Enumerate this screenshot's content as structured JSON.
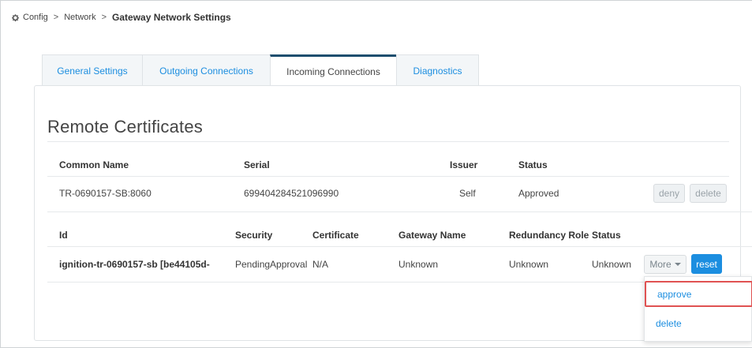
{
  "breadcrumb": {
    "root": "Config",
    "section": "Network",
    "current": "Gateway Network Settings"
  },
  "tabs": [
    {
      "label": "General Settings"
    },
    {
      "label": "Outgoing Connections"
    },
    {
      "label": "Incoming Connections",
      "active": true
    },
    {
      "label": "Diagnostics"
    }
  ],
  "certificates": {
    "title": "Remote Certificates",
    "columns": [
      "Common Name",
      "Serial",
      "Issuer",
      "Status"
    ],
    "rows": [
      {
        "common_name": "TR-0690157-SB:8060",
        "serial": "699404284521096990",
        "issuer": "Self",
        "status": "Approved",
        "deny_label": "deny",
        "delete_label": "delete"
      }
    ]
  },
  "connections": {
    "columns": [
      "Id",
      "Security",
      "Certificate",
      "Gateway Name",
      "Redundancy Role",
      "Status"
    ],
    "rows": [
      {
        "id": "ignition-tr-0690157-sb [be44105d-",
        "security": "PendingApproval",
        "certificate": "N/A",
        "gateway_name": "Unknown",
        "redundancy_role": "Unknown",
        "status": "Unknown",
        "more_label": "More",
        "reset_label": "reset"
      }
    ]
  },
  "more_menu": {
    "items": [
      "approve",
      "delete"
    ],
    "highlighted": "approve"
  },
  "colors": {
    "accent": "#1c8ee0",
    "active_tab_border": "#1d4e6e",
    "highlight_border": "#e05252"
  }
}
